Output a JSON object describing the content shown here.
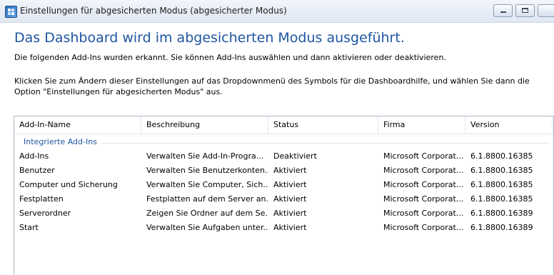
{
  "window": {
    "title": "Einstellungen für abgesicherten Modus (abgesicherter Modus)"
  },
  "content": {
    "heading": "Das Dashboard wird im abgesicherten Modus ausgeführt.",
    "paragraph1": "Die folgenden Add-Ins wurden erkannt. Sie können Add-Ins auswählen und dann aktivieren oder deaktivieren.",
    "paragraph2": "Klicken Sie zum Ändern dieser Einstellungen auf das Dropdownmenü des Symbols für die Dashboardhilfe, und wählen Sie dann die Option \"Einstellungen für abgesicherten Modus\" aus."
  },
  "list": {
    "columns": [
      "Add-In-Name",
      "Beschreibung",
      "Status",
      "Firma",
      "Version"
    ],
    "group": "Integrierte Add-Ins",
    "rows": [
      [
        "Add-Ins",
        "Verwalten Sie Add-In-Progra...",
        "Deaktiviert",
        "Microsoft Corporat...",
        "6.1.8800.16385"
      ],
      [
        "Benutzer",
        "Verwalten Sie Benutzerkonten...",
        "Aktiviert",
        "Microsoft Corporat...",
        "6.1.8800.16385"
      ],
      [
        "Computer und Sicherung",
        "Verwalten Sie Computer, Sich...",
        "Aktiviert",
        "Microsoft Corporat...",
        "6.1.8800.16385"
      ],
      [
        "Festplatten",
        "Festplatten auf dem Server an...",
        "Aktiviert",
        "Microsoft Corporat...",
        "6.1.8800.16385"
      ],
      [
        "Serverordner",
        "Zeigen Sie Ordner auf dem Se...",
        "Aktiviert",
        "Microsoft Corporat...",
        "6.1.8800.16389"
      ],
      [
        "Start",
        "Verwalten Sie Aufgaben unter...",
        "Aktiviert",
        "Microsoft Corporat...",
        "6.1.8800.16389"
      ]
    ]
  },
  "colors": {
    "heading": "#1f56a3",
    "group_label": "#1f56a3"
  },
  "icons": {
    "app": "dashboard-app-icon",
    "minimize": "minimize-icon",
    "maximize": "maximize-icon"
  }
}
